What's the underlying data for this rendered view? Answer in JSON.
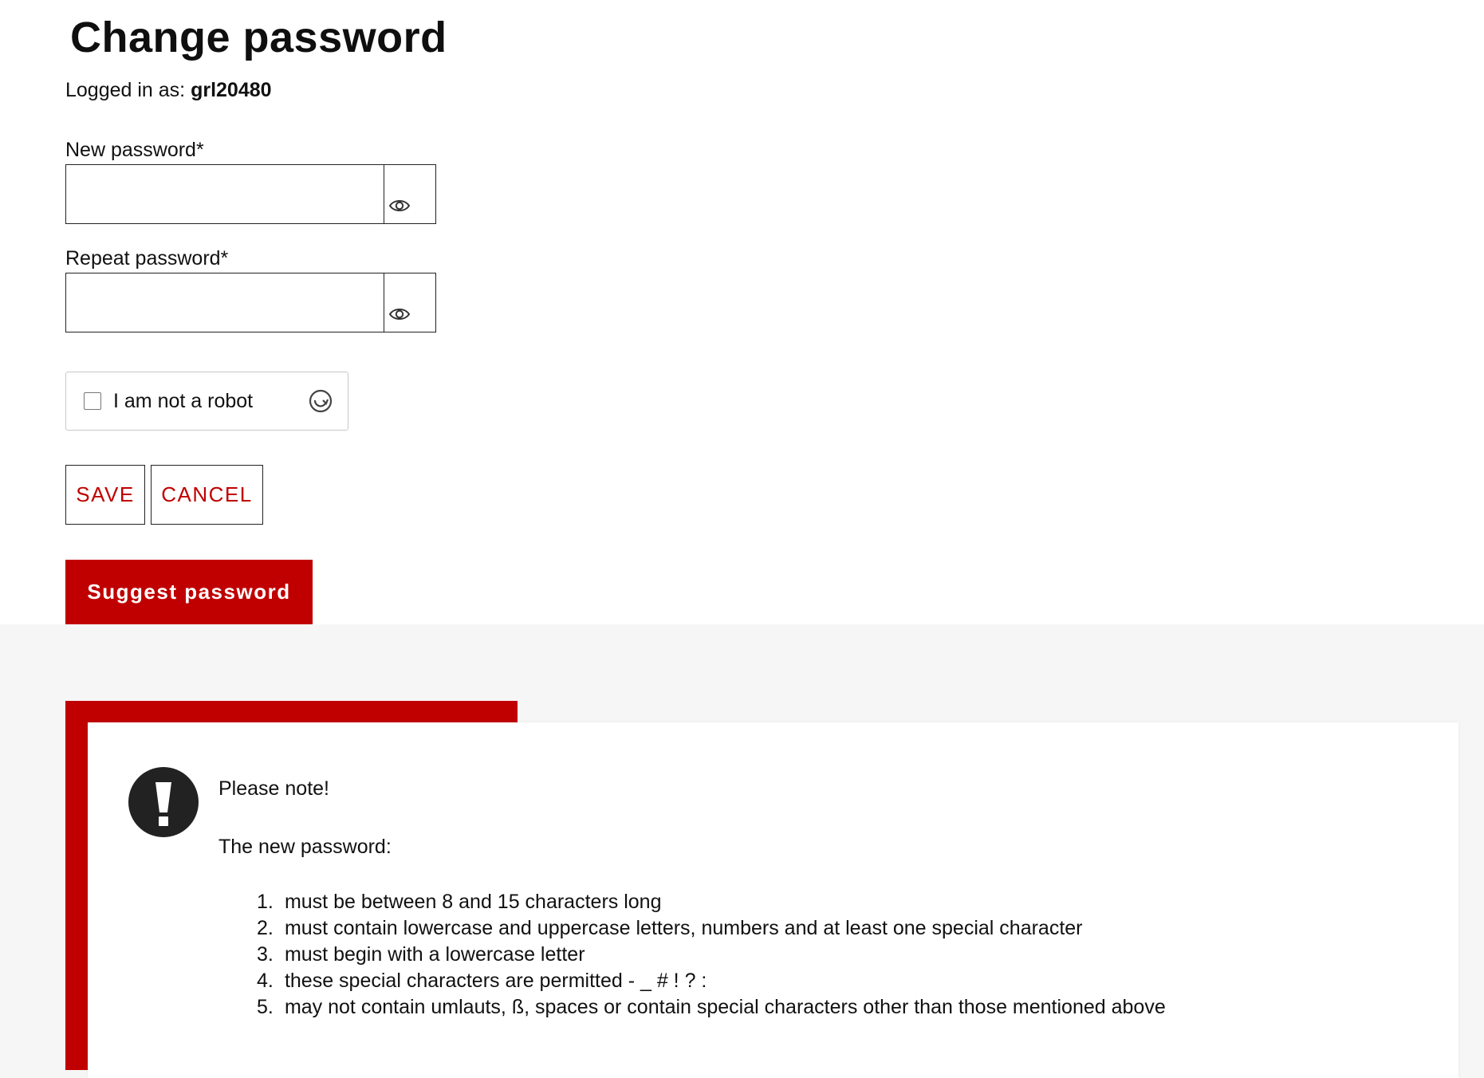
{
  "page": {
    "title": "Change password",
    "logged_in_label": "Logged in as:",
    "username": "grl20480"
  },
  "form": {
    "new_password_label": "New password*",
    "new_password_value": "",
    "repeat_password_label": "Repeat password*",
    "repeat_password_value": "",
    "visibility_icon": "eye-icon"
  },
  "captcha": {
    "label": "I am not a robot",
    "checked": false,
    "refresh_icon": "refresh-icon"
  },
  "buttons": {
    "save": "SAVE",
    "cancel": "CANCEL",
    "suggest": "Suggest password"
  },
  "note": {
    "icon": "exclamation-icon",
    "title": "Please note!",
    "intro": "The new password:",
    "rules": [
      {
        "num": "1.",
        "text": "must be between 8 and 15 characters long"
      },
      {
        "num": "2.",
        "text": "must contain lowercase and uppercase letters, numbers and at least one special character"
      },
      {
        "num": "3.",
        "text": "must begin with a lowercase letter"
      },
      {
        "num": "4.",
        "text": "these special characters are permitted - _ # ! ? :"
      },
      {
        "num": "5.",
        "text": "may not contain umlauts, ß, spaces or contain special characters other than those mentioned above"
      }
    ]
  },
  "colors": {
    "accent": "#c00000",
    "background_band": "#f6f6f6",
    "text": "#111111"
  }
}
